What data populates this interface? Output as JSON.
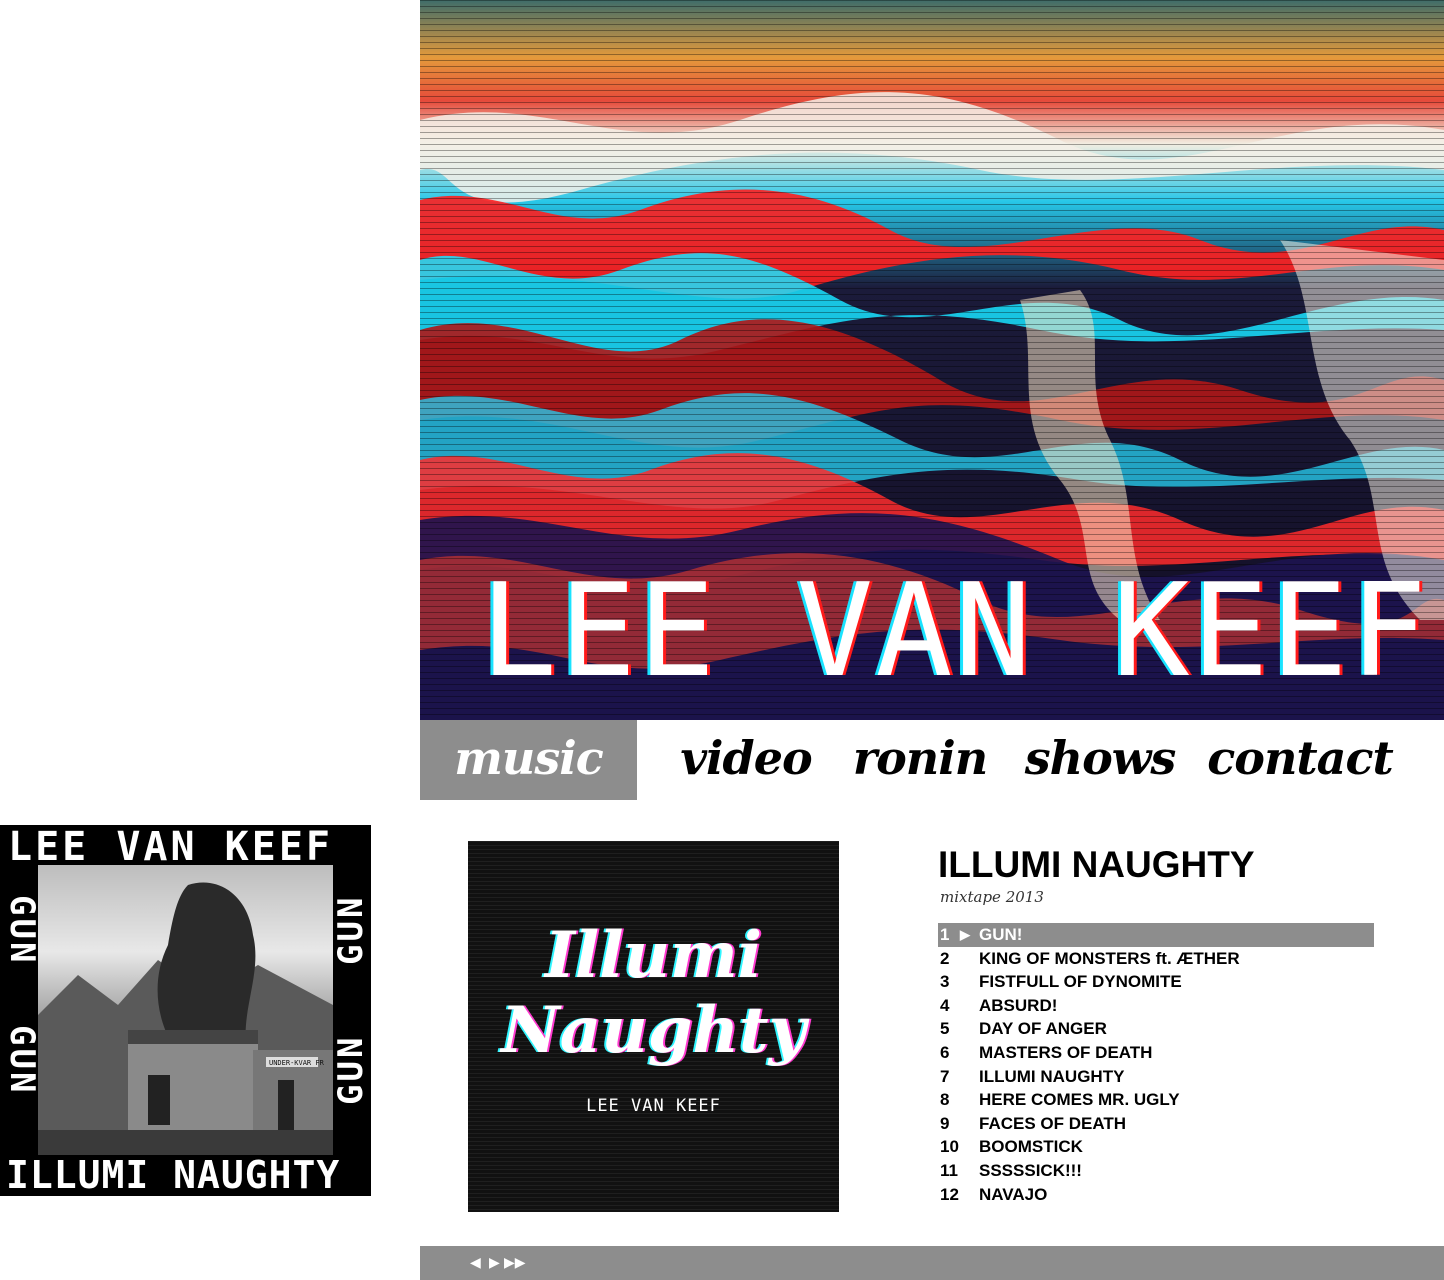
{
  "hero": {
    "artist_name": "LEE VAN KEEF"
  },
  "nav": {
    "items": [
      {
        "label": "music",
        "active": true
      },
      {
        "label": "video",
        "active": false
      },
      {
        "label": "ronin",
        "active": false
      },
      {
        "label": "shows",
        "active": false
      },
      {
        "label": "contact",
        "active": false
      }
    ]
  },
  "left_cover": {
    "top_text": "LEE VAN KEEF",
    "bottom_text": "ILLUMI NAUGHTY",
    "side_text": "GUN",
    "sign_text": "UNDER-KVAR FR"
  },
  "center_cover": {
    "script_line1": "Illumi",
    "script_line2": "Naughty",
    "artist": "LEE VAN KEEF"
  },
  "album": {
    "title": "ILLUMI NAUGHTY",
    "subtitle": "mixtape 2013",
    "tracks": [
      {
        "num": "1",
        "title": "GUN!",
        "active": true
      },
      {
        "num": "2",
        "title": "KING OF MONSTERS ft. ÆTHER"
      },
      {
        "num": "3",
        "title": "FISTFULL OF DYNOMITE"
      },
      {
        "num": "4",
        "title": "ABSURD!"
      },
      {
        "num": "5",
        "title": "DAY OF ANGER"
      },
      {
        "num": "6",
        "title": "MASTERS OF DEATH"
      },
      {
        "num": "7",
        "title": "ILLUMI NAUGHTY"
      },
      {
        "num": "8",
        "title": "HERE COMES MR. UGLY"
      },
      {
        "num": "9",
        "title": "FACES OF DEATH"
      },
      {
        "num": "10",
        "title": "BOOMSTICK"
      },
      {
        "num": "11",
        "title": "SSSSSICK!!!"
      },
      {
        "num": "12",
        "title": "NAVAJO"
      }
    ]
  },
  "player": {
    "prev_icon": "prev-icon",
    "play_icon": "play-icon",
    "next_icon": "next-icon"
  },
  "colors": {
    "nav_active_bg": "#8d8d8d",
    "player_bar": "#8d8d8d",
    "glitch_red": "#ff1a1a",
    "glitch_cyan": "#19e3ff",
    "glitch_navy": "#1a1a5e"
  }
}
